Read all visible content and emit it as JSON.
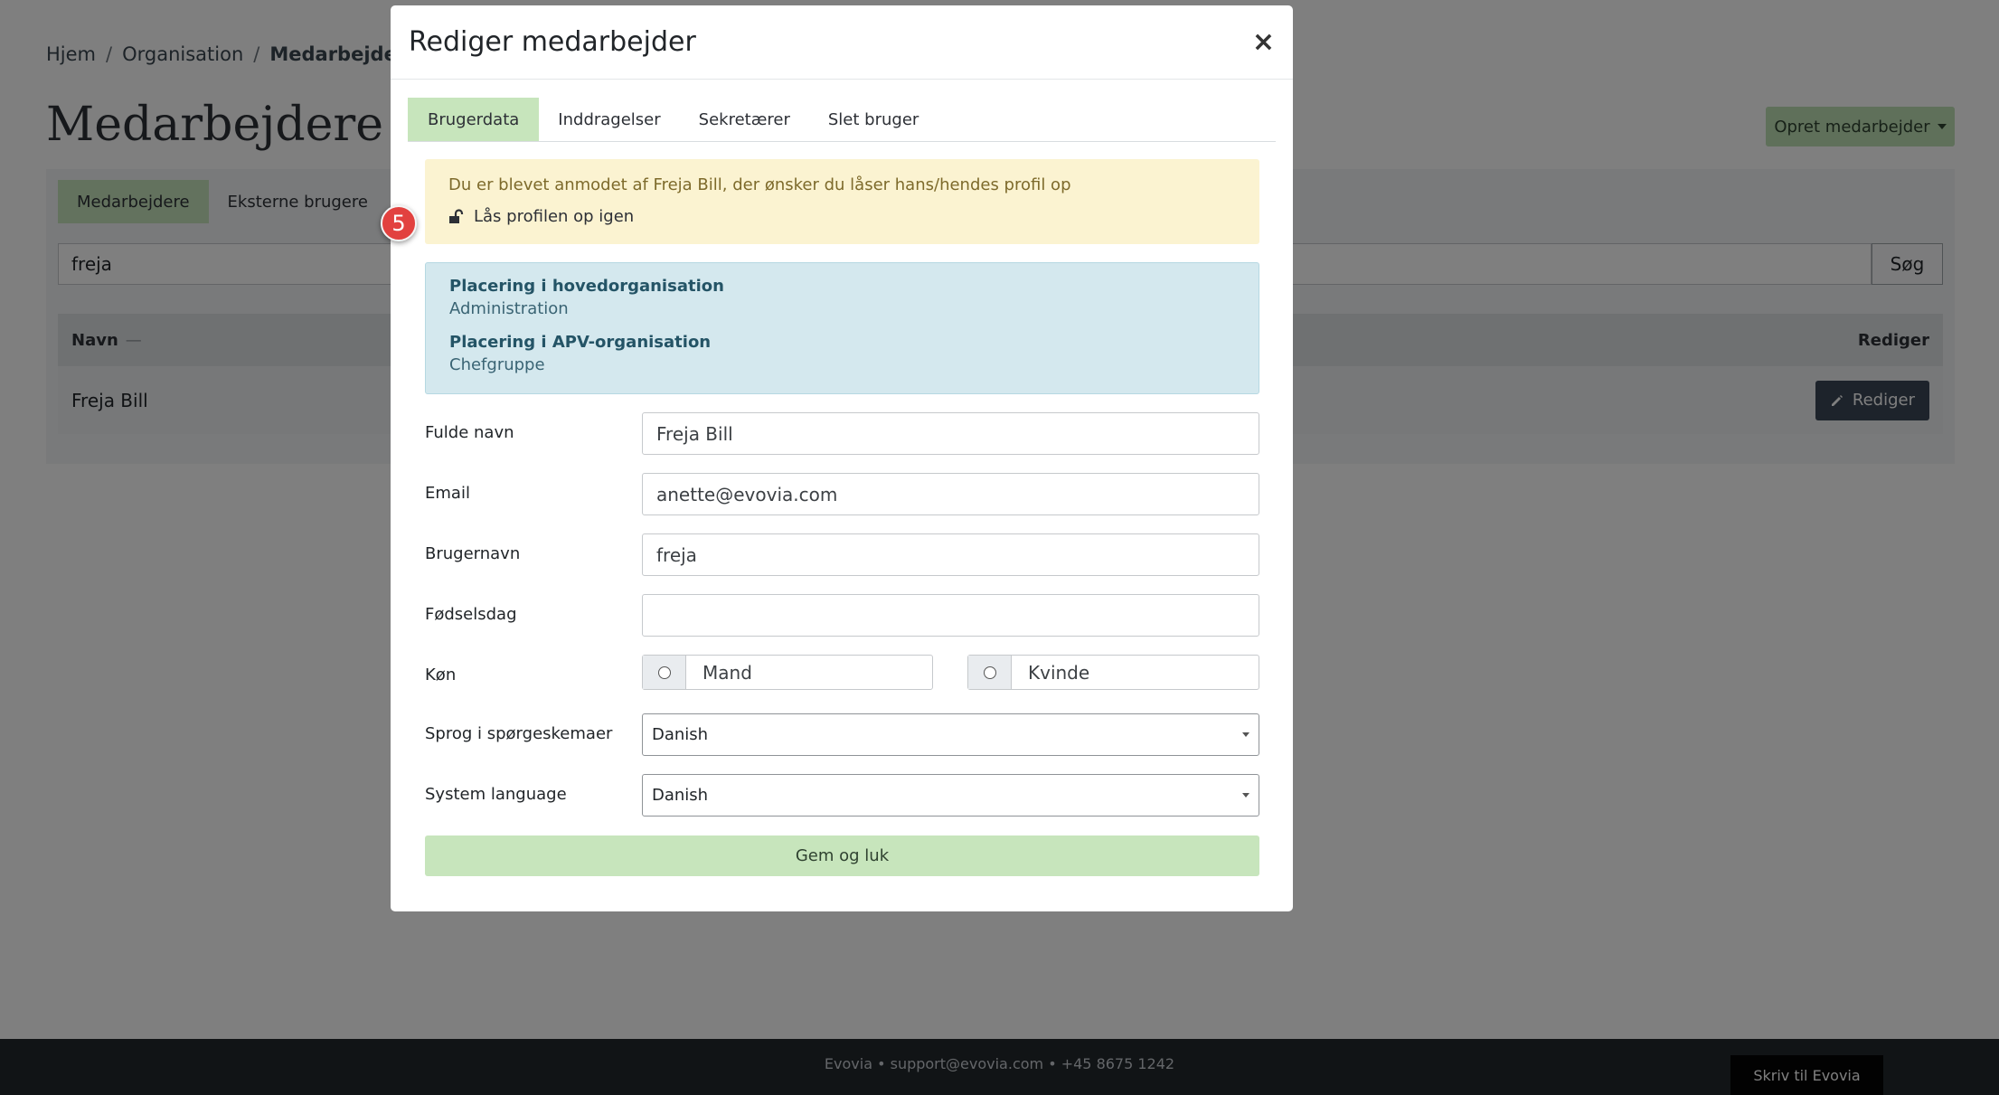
{
  "breadcrumb": {
    "home": "Hjem",
    "organisation": "Organisation",
    "current": "Medarbejdere"
  },
  "page": {
    "title": "Medarbejdere",
    "create_button": "Opret medarbejder",
    "tabs": [
      "Medarbejdere",
      "Eksterne brugere"
    ],
    "search": {
      "value": "freja",
      "button": "Søg"
    },
    "table": {
      "col_name": "Navn",
      "col_sort_indicator": "—",
      "col_edit": "Rediger",
      "rows": [
        {
          "name": "Freja Bill",
          "edit_label": "Rediger"
        }
      ]
    }
  },
  "footer": {
    "text": "Evovia • support@evovia.com • +45 8675 1242",
    "chat_button": "Skriv til Evovia"
  },
  "modal": {
    "title": "Rediger medarbejder",
    "close": "×",
    "tabs": [
      "Brugerdata",
      "Inddragelser",
      "Sekretærer",
      "Slet bruger"
    ],
    "active_tab": "Brugerdata",
    "warning": {
      "message": "Du er blevet anmodet af Freja Bill, der ønsker du låser hans/hendes profil op",
      "link": "Lås profilen op igen"
    },
    "info": {
      "main_org_label": "Placering i hovedorganisation",
      "main_org_value": "Administration",
      "apv_org_label": "Placering i APV-organisation",
      "apv_org_value": "Chefgruppe"
    },
    "form": {
      "full_name_label": "Fulde navn",
      "full_name_value": "Freja Bill",
      "email_label": "Email",
      "email_value": "anette@evovia.com",
      "username_label": "Brugernavn",
      "username_value": "freja",
      "birthday_label": "Fødselsdag",
      "birthday_value": "",
      "gender_label": "Køn",
      "gender_options": [
        "Mand",
        "Kvinde"
      ],
      "survey_lang_label": "Sprog i spørgeskemaer",
      "survey_lang_value": "Danish",
      "system_lang_label": "System language",
      "system_lang_value": "Danish"
    },
    "save_button": "Gem og luk"
  },
  "step_badge": "5",
  "colors": {
    "accent_green": "#c7e5bc",
    "dark_button": "#3a4656",
    "warning_bg": "#fbf3d1",
    "info_bg": "#d4e8ee",
    "badge_red": "#e2413f"
  }
}
